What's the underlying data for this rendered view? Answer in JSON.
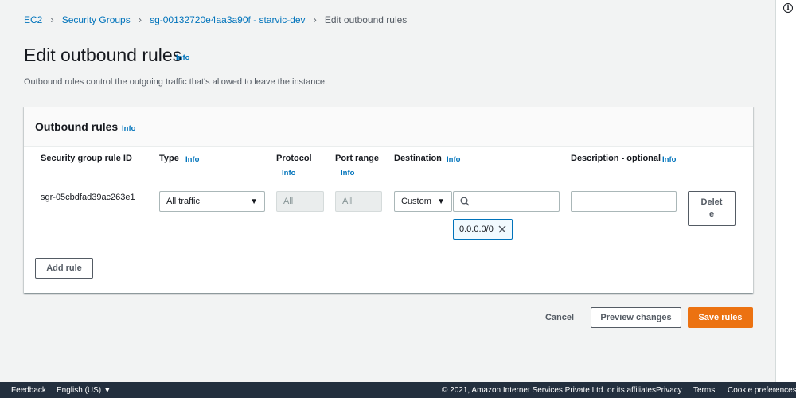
{
  "breadcrumb": {
    "items": [
      "EC2",
      "Security Groups",
      "sg-00132720e4aa3a90f - starvic-dev"
    ],
    "current": "Edit outbound rules"
  },
  "page": {
    "title": "Edit outbound rules",
    "info": "Info",
    "description": "Outbound rules control the outgoing traffic that's allowed to leave the instance."
  },
  "panel": {
    "title": "Outbound rules",
    "info": "Info",
    "columns": {
      "rule_id": "Security group rule ID",
      "type": "Type",
      "type_info": "Info",
      "protocol": "Protocol",
      "protocol_info": "Info",
      "port_range": "Port range",
      "port_range_info": "Info",
      "destination": "Destination",
      "destination_info": "Info",
      "description": "Description - optional",
      "description_info": "Info"
    },
    "rule": {
      "id": "sgr-05cbdfad39ac263e1",
      "type": "All traffic",
      "protocol": "All",
      "port_range": "All",
      "destination_mode": "Custom",
      "destination_search": "",
      "destination_token": "0.0.0.0/0",
      "description": "",
      "delete_label": "Delete"
    },
    "add_rule_label": "Add rule"
  },
  "actions": {
    "cancel": "Cancel",
    "preview": "Preview changes",
    "save": "Save rules"
  },
  "footer": {
    "feedback": "Feedback",
    "language": "English (US) ▼",
    "copyright": "© 2021, Amazon Internet Services Private Ltd. or its affiliates.",
    "privacy": "Privacy",
    "terms": "Terms",
    "cookies": "Cookie preferences"
  },
  "colors": {
    "link": "#0073bb",
    "primary": "#ec7211",
    "footer_bg": "#232f3e",
    "page_bg": "#f2f3f3"
  }
}
